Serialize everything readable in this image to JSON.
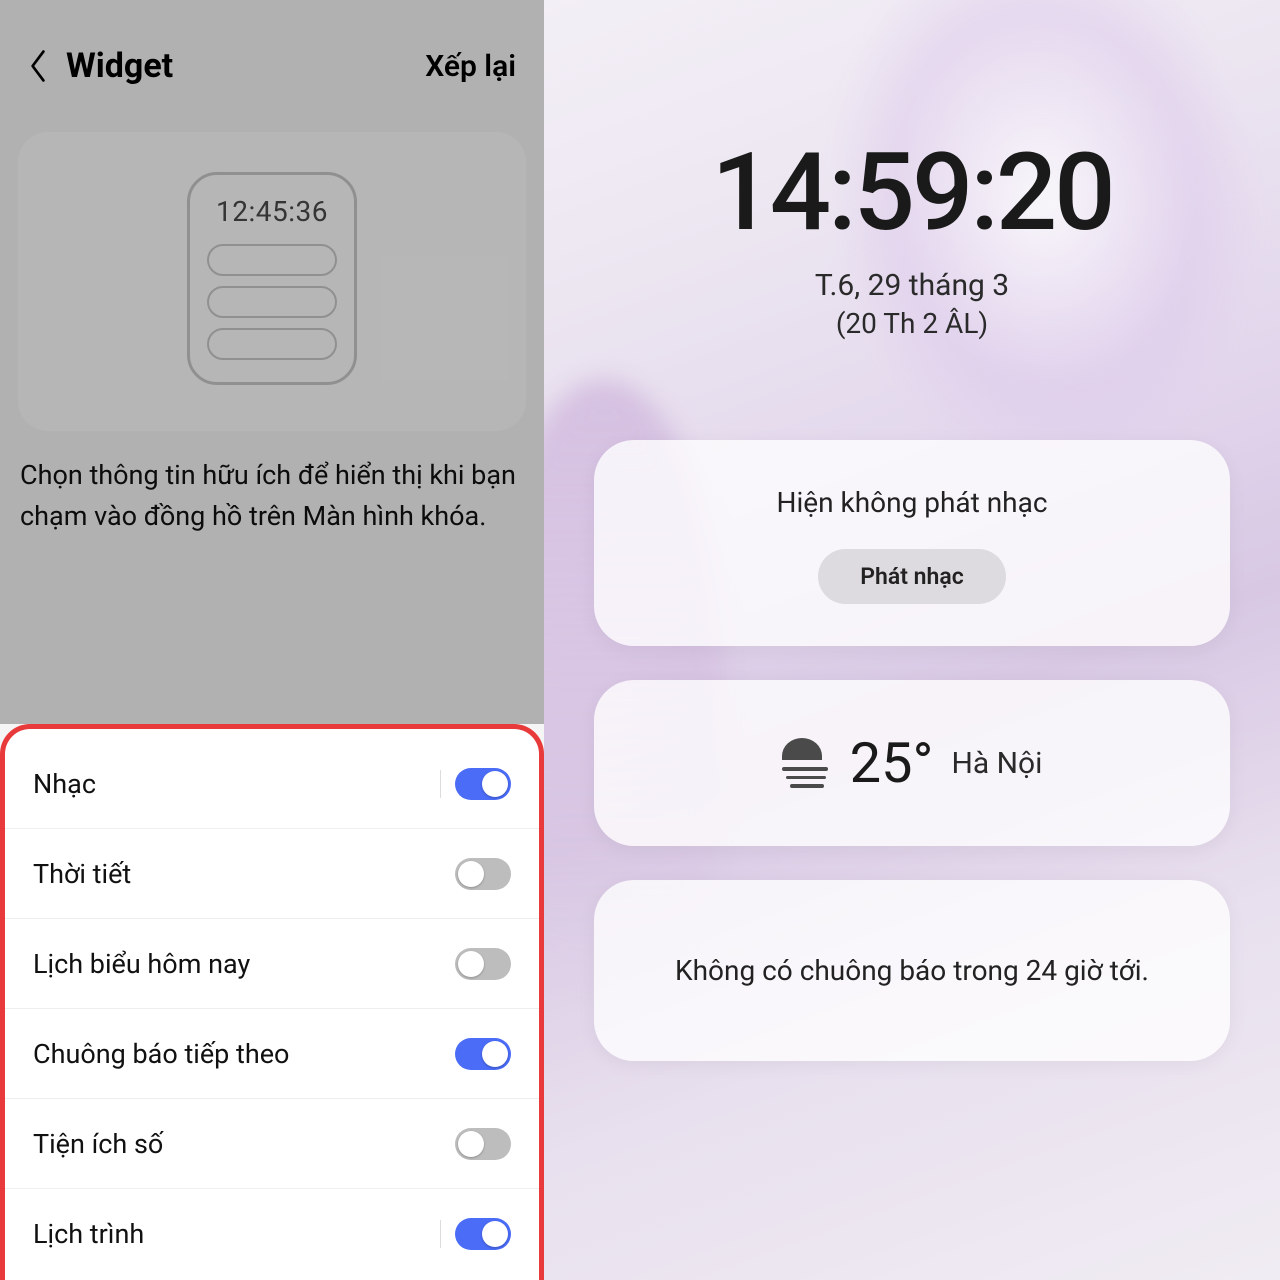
{
  "left": {
    "header": {
      "title": "Widget",
      "reorder": "Xếp lại"
    },
    "preview_time": "12:45:36",
    "description": "Chọn thông tin hữu ích để hiển thị khi bạn chạm vào đồng hồ trên Màn hình khóa.",
    "toggles": [
      {
        "label": "Nhạc",
        "on": true
      },
      {
        "label": "Thời tiết",
        "on": false
      },
      {
        "label": "Lịch biểu hôm nay",
        "on": false
      },
      {
        "label": "Chuông báo tiếp theo",
        "on": true
      },
      {
        "label": "Tiện ích số",
        "on": false
      },
      {
        "label": "Lịch trình",
        "on": true
      }
    ]
  },
  "right": {
    "time": "14:59:20",
    "date": "T.6, 29 tháng 3",
    "lunar": "(20 Th 2 ÂL)",
    "music": {
      "status": "Hiện không phát nhạc",
      "button": "Phát nhạc"
    },
    "weather": {
      "temp": "25°",
      "city": "Hà Nội"
    },
    "alarm": "Không có chuông báo trong 24 giờ tới."
  }
}
